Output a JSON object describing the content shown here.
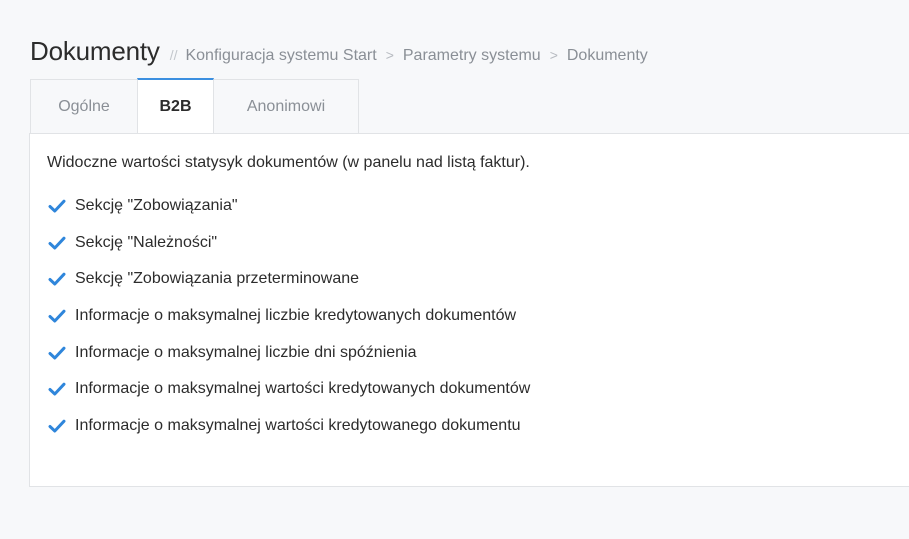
{
  "header": {
    "title": "Dokumenty",
    "separator": "//",
    "breadcrumb": [
      "Konfiguracja systemu Start",
      "Parametry systemu",
      "Dokumenty"
    ],
    "breadcrumb_separator": ">"
  },
  "tabs": [
    {
      "label": "Ogólne",
      "active": false
    },
    {
      "label": "B2B",
      "active": true
    },
    {
      "label": "Anonimowi",
      "active": false
    }
  ],
  "b2b": {
    "description": "Widoczne wartości statysyk dokumentów (w panelu nad listą faktur).",
    "options": [
      {
        "label": "Sekcję \"Zobowiązania\"",
        "checked": true
      },
      {
        "label": "Sekcję \"Należności\"",
        "checked": true
      },
      {
        "label": "Sekcję \"Zobowiązania przeterminowane",
        "checked": true
      },
      {
        "label": "Informacje o maksymalnej liczbie kredytowanych dokumentów",
        "checked": true
      },
      {
        "label": "Informacje o maksymalnej liczbie dni spóźnienia",
        "checked": true
      },
      {
        "label": "Informacje o maksymalnej wartości kredytowanych dokumentów",
        "checked": true
      },
      {
        "label": "Informacje o maksymalnej wartości kredytowanego dokumentu",
        "checked": true
      }
    ]
  },
  "colors": {
    "accent": "#3b8fe0",
    "check": "#2f86db",
    "border": "#e1e3e6",
    "muted_text": "#8a8f96"
  },
  "icons": {
    "checkbox": "check-icon"
  }
}
